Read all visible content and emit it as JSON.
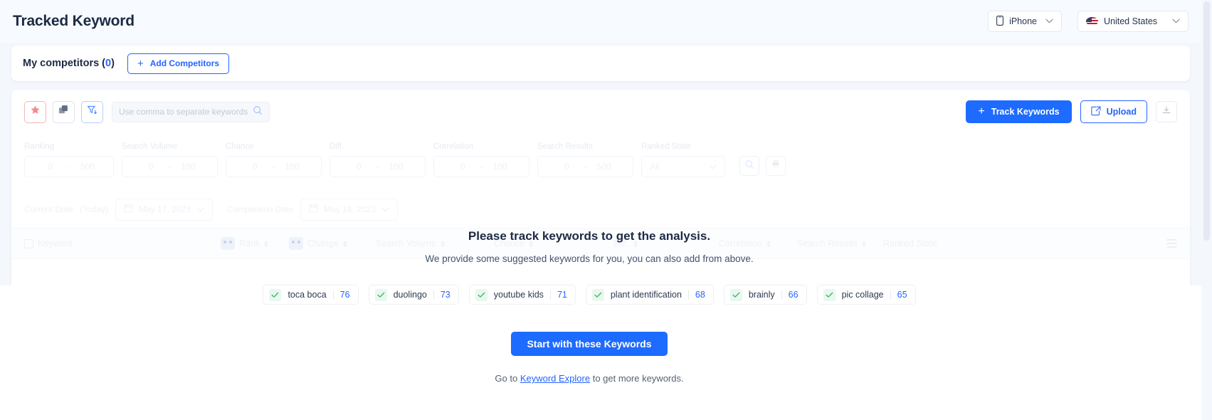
{
  "header": {
    "title": "Tracked Keyword",
    "device_selector": {
      "label": "iPhone",
      "icon": "phone-icon",
      "chevron": "⌄"
    },
    "country_selector": {
      "label": "United States",
      "icon": "us-flag-icon",
      "chevron": "⌄"
    }
  },
  "competitors": {
    "title_prefix": "My competitors (",
    "count": "0",
    "title_suffix": ")",
    "add_label": "Add Competitors",
    "plus": "+"
  },
  "toolbar": {
    "star_icon": "star-icon",
    "copy_icon": "copy-icon",
    "filter_icon": "filter-icon",
    "search_placeholder": "Use comma to separate keywords",
    "search_value": "",
    "track_label": "Track Keywords",
    "track_plus": "+",
    "upload_label": "Upload",
    "download_icon": "download-icon"
  },
  "filters": [
    {
      "label": "Ranking",
      "min": "0",
      "dash": "-",
      "max": "500"
    },
    {
      "label": "Search Volume",
      "min": "0",
      "dash": "-",
      "max": "100"
    },
    {
      "label": "Chance",
      "min": "0",
      "dash": "-",
      "max": "100"
    },
    {
      "label": "Diff.",
      "min": "0",
      "dash": "-",
      "max": "100"
    },
    {
      "label": "Correlation",
      "min": "0",
      "dash": "-",
      "max": "100"
    },
    {
      "label": "Search Results",
      "min": "0",
      "dash": "-",
      "max": "500"
    }
  ],
  "ranked_state": {
    "label": "Ranked State",
    "value": "All",
    "chevron": "⌄"
  },
  "filter_actions": {
    "search_icon": "search-icon",
    "clear_icon": "clear-filter-icon"
  },
  "dates": {
    "current_label": "Current Date",
    "current_today": "(Today)",
    "current_value": "May 17, 2023",
    "comparison_label": "Comparison Date",
    "comparison_value": "May 16, 2023",
    "chevron": "⌄"
  },
  "table": {
    "columns": [
      {
        "label": "Keyword",
        "sortable": false,
        "checkbox": true,
        "bot": false
      },
      {
        "label": "Rank",
        "sortable": true,
        "checkbox": false,
        "bot": true
      },
      {
        "label": "Change",
        "sortable": true,
        "checkbox": false,
        "bot": true
      },
      {
        "label": "Search Volume",
        "sortable": true,
        "checkbox": false,
        "bot": false
      },
      {
        "label": "Chance",
        "sortable": true,
        "checkbox": false,
        "bot": false
      },
      {
        "label": "Diff.",
        "sortable": true,
        "checkbox": false,
        "bot": false
      },
      {
        "label": "Correlation",
        "sortable": true,
        "checkbox": false,
        "bot": false
      },
      {
        "label": "Search Results",
        "sortable": true,
        "checkbox": false,
        "bot": false
      },
      {
        "label": "Ranked State",
        "sortable": false,
        "checkbox": false,
        "bot": false
      }
    ],
    "menu_icon": "hamburger-icon"
  },
  "empty_state": {
    "title": "Please track keywords to get the analysis.",
    "subtitle": "We provide some suggested keywords for you, you can also add from above.",
    "chips": [
      {
        "keyword": "toca boca",
        "score": "76"
      },
      {
        "keyword": "duolingo",
        "score": "73"
      },
      {
        "keyword": "youtube kids",
        "score": "71"
      },
      {
        "keyword": "plant identification",
        "score": "68"
      },
      {
        "keyword": "brainly",
        "score": "66"
      },
      {
        "keyword": "pic collage",
        "score": "65"
      }
    ],
    "start_button": "Start with these Keywords",
    "footer_prefix": "Go to ",
    "footer_link": "Keyword Explore",
    "footer_suffix": " to get more keywords."
  },
  "colors": {
    "accent_blue": "#1d6bff",
    "link_blue": "#2563ff",
    "title_dark": "#1d2a44",
    "chip_check_green": "#3cb46e",
    "page_bg": "#f4f7fc"
  }
}
